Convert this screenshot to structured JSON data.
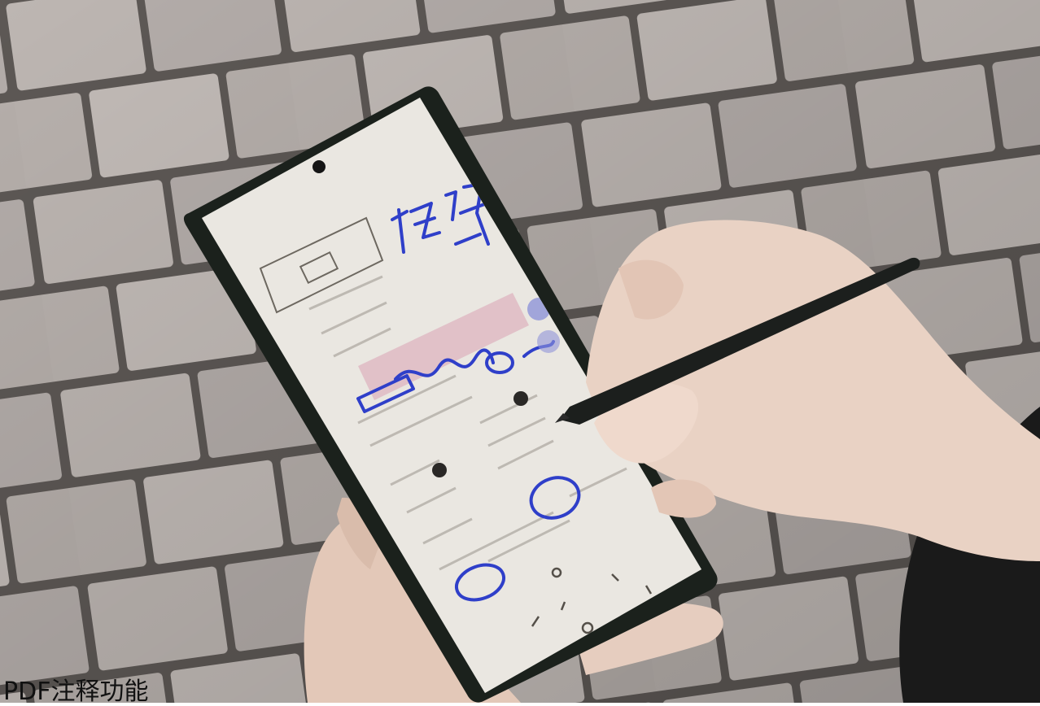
{
  "caption": "PDF注释功能",
  "photo": {
    "subject": "phone-with-stylus-annotating-pdf",
    "colors": {
      "brick": "#b9b2ae",
      "mortar": "#5a5552",
      "phone_body": "#1b211c",
      "screen": "#ecebe6",
      "ink_blue": "#2f3fc9",
      "skin": "#e9d2c4",
      "stylus": "#1c1f1d",
      "jacket": "#1a1a1a"
    }
  }
}
